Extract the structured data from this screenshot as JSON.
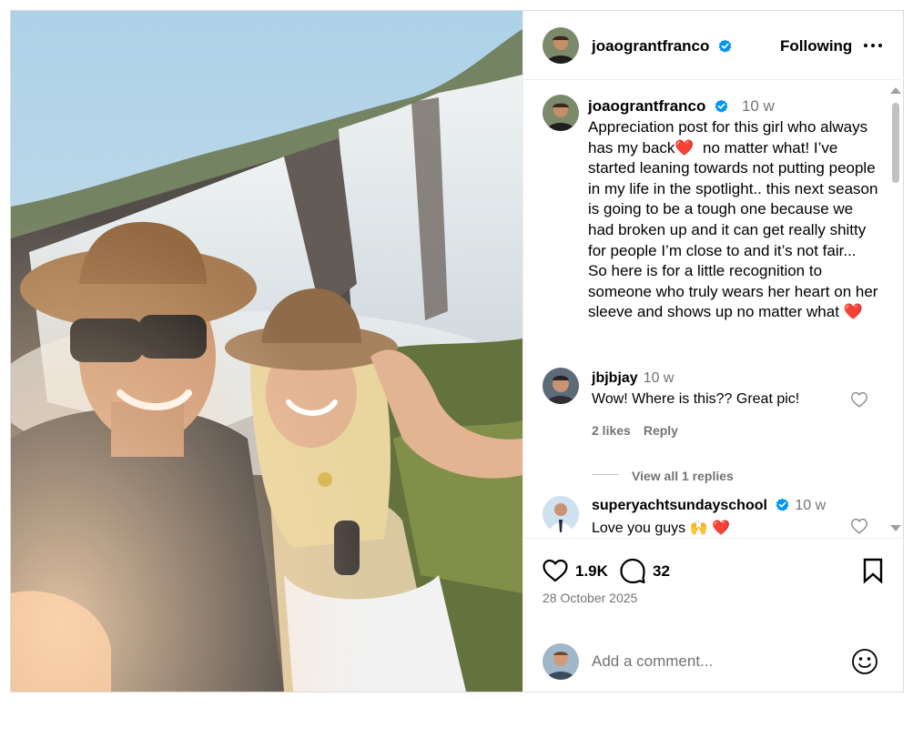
{
  "header": {
    "username": "joaograntfranco",
    "follow_label": "Following",
    "more_icon": "more-horizontal-icon"
  },
  "caption": {
    "username": "joaograntfranco",
    "time": "10 w",
    "text": "Appreciation post for this girl who always has my back❤️  no matter what! I’ve started leaning towards not putting people in my life in the spotlight.. this next season is going to be a tough one because we had broken up and it can get really shitty for people I’m close to and it’s not fair...  So here is for a little recognition to someone who truly wears her heart on her sleeve and shows up no matter what ❤️"
  },
  "comments": [
    {
      "username": "jbjbjay",
      "time": "10 w",
      "text": "Wow! Where is this?? Great pic!",
      "likes": "2 likes",
      "reply_label": "Reply",
      "view_replies": "View all 1 replies"
    },
    {
      "username": "superyachtsundayschool",
      "time": "10 w",
      "text": "Love you guys 🙌 ❤️"
    }
  ],
  "actions": {
    "likes": "1.9K",
    "comments": "32",
    "date": "28 October 2025"
  },
  "add_comment": {
    "placeholder": "Add a comment..."
  },
  "colors": {
    "verified": "#0095f6",
    "muted_text": "#737373",
    "border": "#dbdbdb"
  }
}
